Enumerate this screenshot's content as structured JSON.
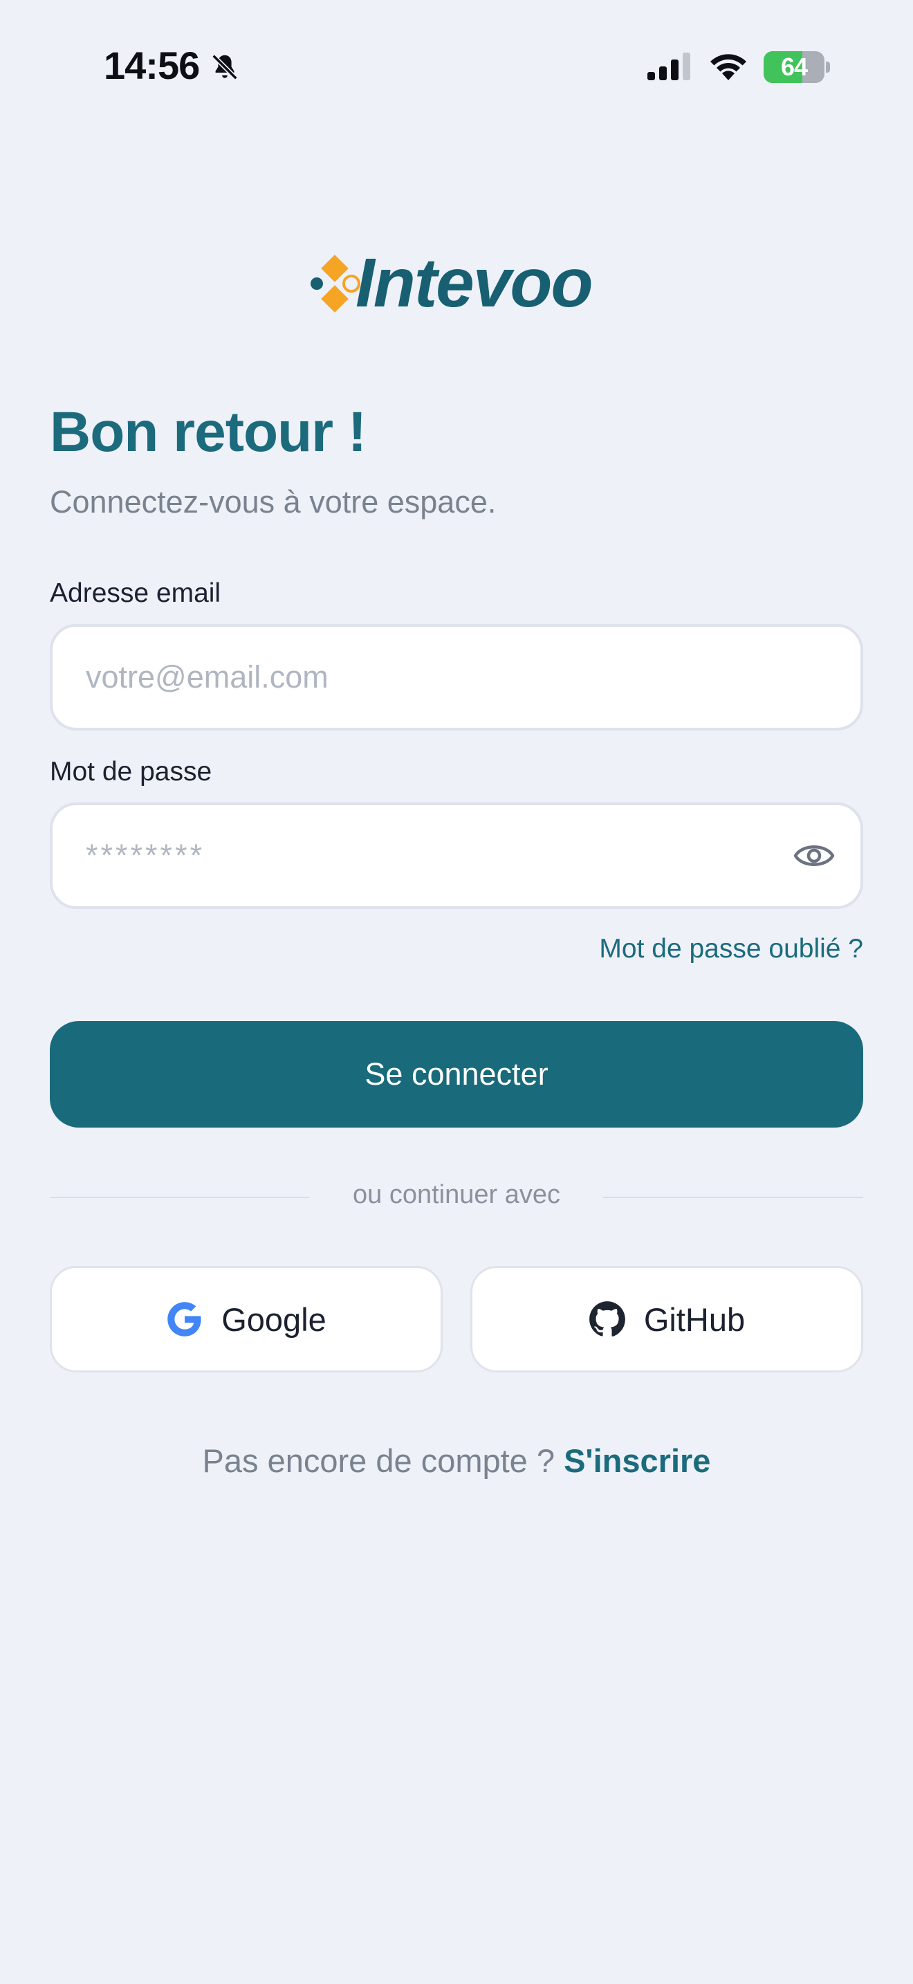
{
  "status_bar": {
    "time": "14:56",
    "battery_percent": "64",
    "battery_level": 0.64
  },
  "logo": {
    "text": "Intevoo",
    "brand_color": "#185f72",
    "accent_color": "#f5a523"
  },
  "header": {
    "title": "Bon retour !",
    "subtitle": "Connectez-vous à votre espace."
  },
  "form": {
    "email_label": "Adresse email",
    "email_placeholder": "votre@email.com",
    "email_value": "",
    "password_label": "Mot de passe",
    "password_placeholder": "••••••••",
    "password_display": "********",
    "forgot_link": "Mot de passe oublié ?",
    "submit_label": "Se connecter"
  },
  "divider": {
    "text": "ou continuer avec"
  },
  "social": {
    "google_label": "Google",
    "github_label": "GitHub"
  },
  "footer": {
    "prompt": "Pas encore de compte ?",
    "signup_link": "S'inscrire"
  },
  "colors": {
    "background": "#eef1f8",
    "primary": "#196a7b",
    "muted_text": "#7a828f"
  }
}
